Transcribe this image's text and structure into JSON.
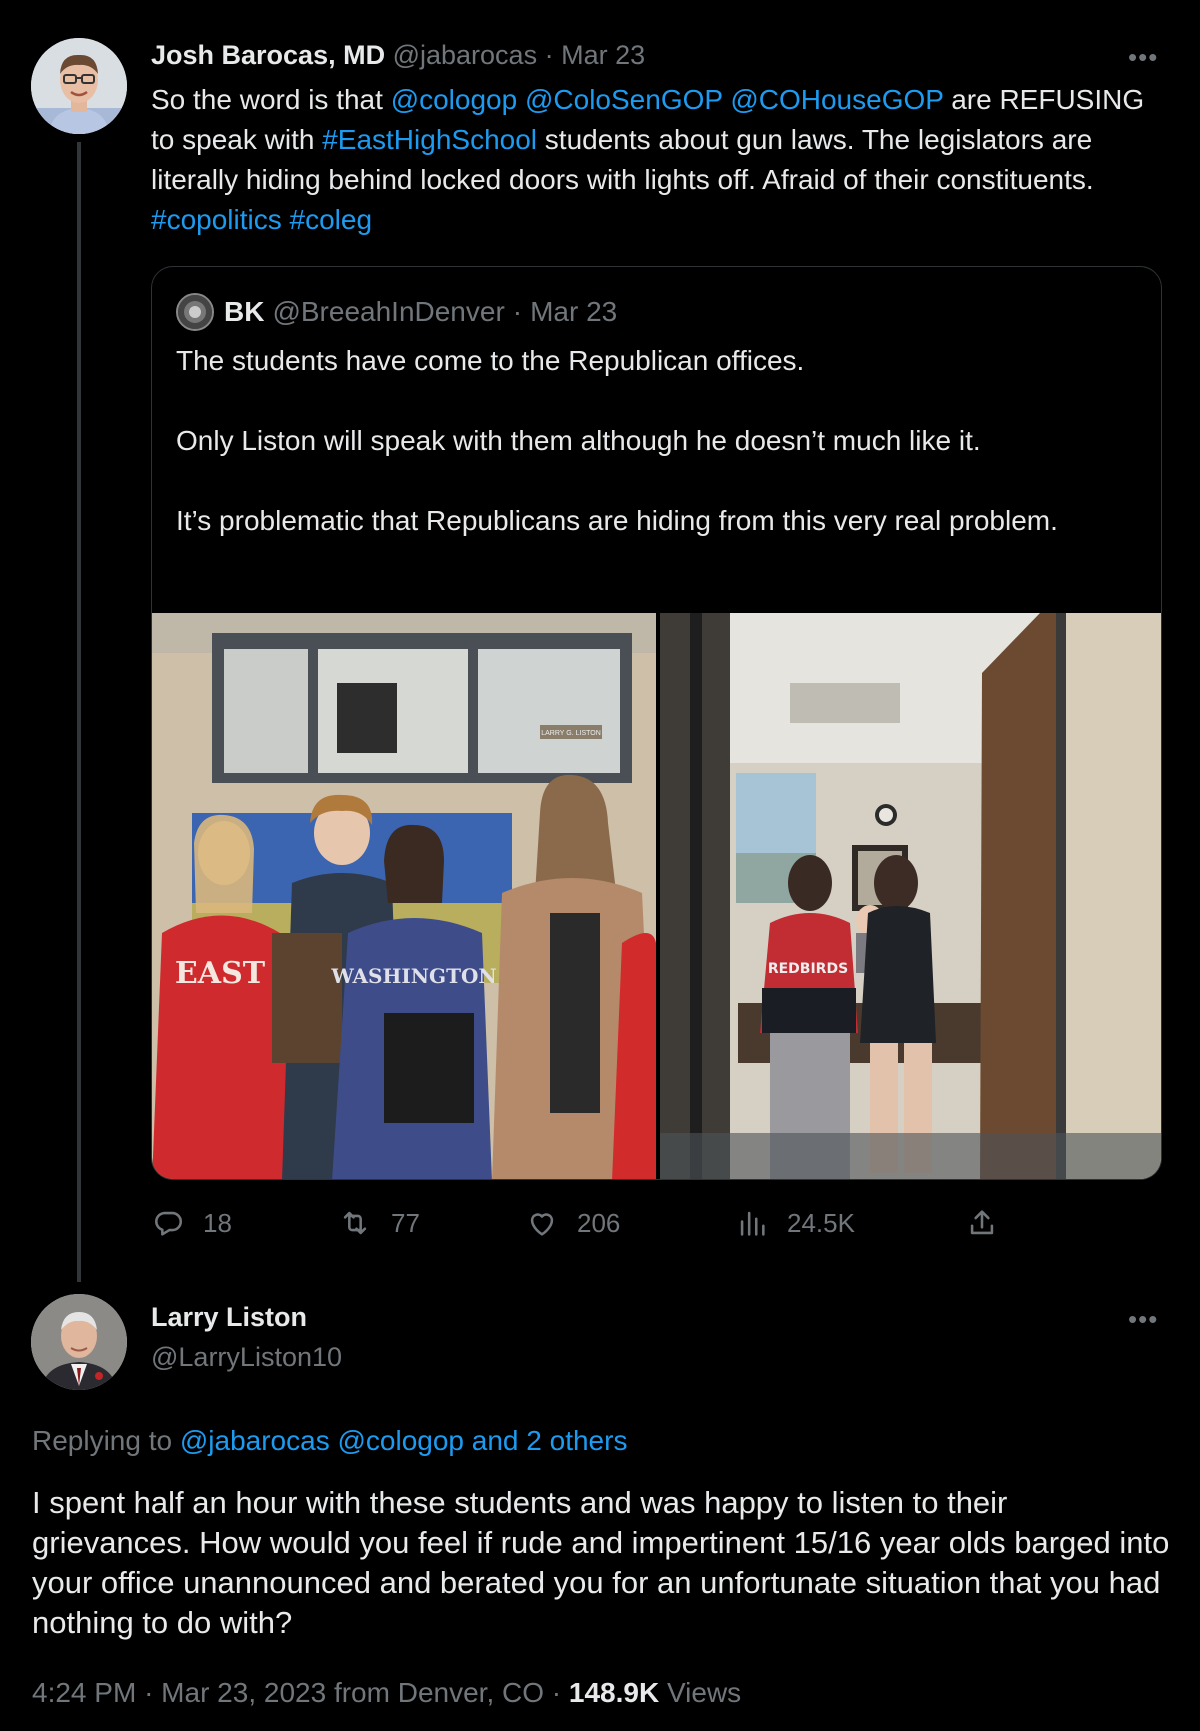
{
  "tweet": {
    "author_name": "Josh Barocas, MD",
    "handle": "@jabarocas",
    "separator": "·",
    "date": "Mar 23",
    "more": "•••",
    "text_parts": [
      {
        "t": "So the word is that ",
        "link": false
      },
      {
        "t": "@cologop",
        "link": true
      },
      {
        "t": " ",
        "link": false
      },
      {
        "t": "@ColoSenGOP",
        "link": true
      },
      {
        "t": " ",
        "link": false
      },
      {
        "t": "@COHouseGOP",
        "link": true
      },
      {
        "t": " are REFUSING to speak with ",
        "link": false
      },
      {
        "t": "#EastHighSchool",
        "link": true
      },
      {
        "t": " students about gun laws. The legislators are literally hiding behind locked doors with lights off. Afraid of their constituents. ",
        "link": false
      },
      {
        "t": "#copolitics",
        "link": true
      },
      {
        "t": " ",
        "link": false
      },
      {
        "t": "#coleg",
        "link": true
      }
    ]
  },
  "quote": {
    "author_name": "BK",
    "handle": "@BreeahInDenver",
    "separator": "·",
    "date": "Mar 23",
    "paragraphs": [
      "The students have come to the Republican offices.",
      "Only Liston will speak with them although he doesn’t much like it.",
      "It’s problematic that Republicans are hiding from this very real problem."
    ],
    "photo_left": {
      "sweatshirt_1": "EAST",
      "sweatshirt_2": "WASHINGTON",
      "sign": "LARRY G. LISTON"
    },
    "photo_right": {
      "sweatshirt": "REDBIRDS"
    }
  },
  "actions": {
    "replies": "18",
    "retweets": "77",
    "likes": "206",
    "views": "24.5K"
  },
  "reply": {
    "author_name": "Larry Liston",
    "handle": "@LarryListon10",
    "more": "•••",
    "replying_prefix": "Replying to ",
    "replying_links": "@jabarocas @cologop and 2 others",
    "text": "I spent half an hour with these students and was happy to listen to their grievances. How would you feel if rude and impertinent 15/16 year olds barged into your office unannounced and berated you for an unfortunate situation that you had nothing to do with?",
    "time": "4:24 PM",
    "date": "Mar 23, 2023",
    "location": "from Denver, CO",
    "views_count": "148.9K",
    "views_label": "Views"
  },
  "icons": [
    "reply-icon",
    "retweet-icon",
    "like-icon",
    "views-icon",
    "share-icon",
    "more-icon"
  ],
  "colors": {
    "background": "#000000",
    "text": "#e7e9ea",
    "muted": "#71767b",
    "link": "#1d9bf0",
    "border": "#2f3336"
  }
}
